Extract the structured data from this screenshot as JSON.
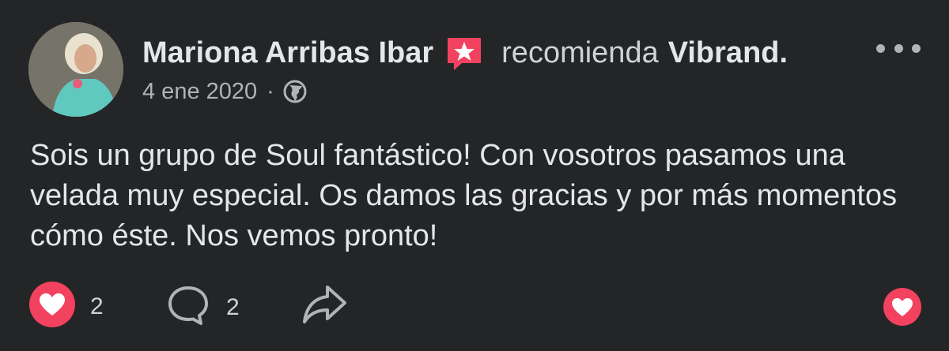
{
  "post": {
    "author": "Mariona Arribas Ibar",
    "action": "recomienda",
    "page_name": "Vibrand.",
    "date": "4 ene 2020",
    "separator": "·",
    "text": "Sois un grupo de Soul fantástico! Con vosotros pasamos una velada muy especial. Os damos las gracias y por más momentos cómo éste. Nos vemos pronto!"
  },
  "footer": {
    "like_count": "2",
    "comment_count": "2"
  },
  "colors": {
    "background": "#242526",
    "accent_red": "#f3425f",
    "text": "#e4e6eb",
    "muted": "#b0b3b8"
  },
  "icons": [
    "recommend-badge-icon",
    "globe-icon",
    "more-icon",
    "love-reaction-icon",
    "comment-icon",
    "share-icon",
    "love-react-button-icon"
  ]
}
